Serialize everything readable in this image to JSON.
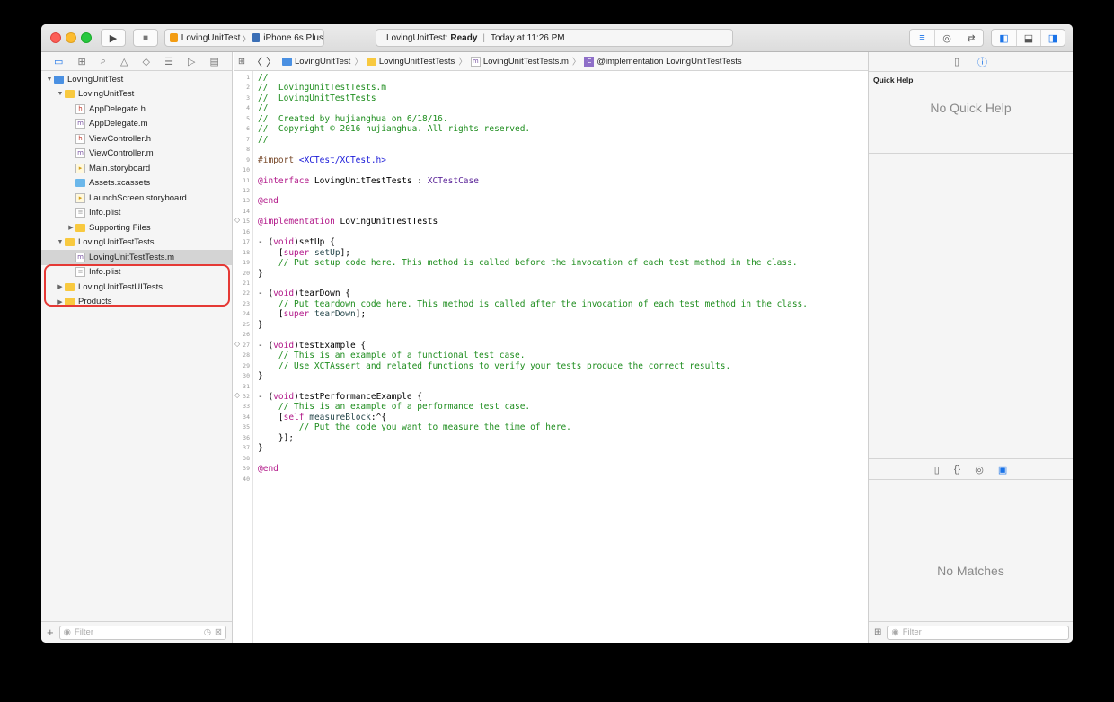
{
  "toolbar": {
    "run_icon": "▶",
    "stop_icon": "■",
    "scheme_name": "LovingUnitTest",
    "scheme_separator": "〉",
    "device_name": "iPhone 6s Plus",
    "status_project": "LovingUnitTest:",
    "status_state": "Ready",
    "status_divider": "|",
    "status_time": "Today at 11:26 PM",
    "editor_modes": [
      "standard-editor-icon",
      "assistant-editor-icon",
      "version-editor-icon"
    ],
    "panel_toggles": [
      "navigator-toggle-icon",
      "debug-toggle-icon",
      "utilities-toggle-icon"
    ]
  },
  "navigator": {
    "tabs": [
      "folder-icon",
      "symbol-icon",
      "search-icon",
      "issue-icon",
      "test-icon",
      "debug-icon",
      "breakpoint-icon",
      "report-icon"
    ],
    "items": [
      {
        "label": "LovingUnitTest",
        "kind": "project",
        "depth": 0,
        "disclosure": "▼"
      },
      {
        "label": "LovingUnitTest",
        "kind": "folder",
        "depth": 1,
        "disclosure": "▼"
      },
      {
        "label": "AppDelegate.h",
        "kind": "h",
        "depth": 2,
        "disclosure": ""
      },
      {
        "label": "AppDelegate.m",
        "kind": "m",
        "depth": 2,
        "disclosure": ""
      },
      {
        "label": "ViewController.h",
        "kind": "h",
        "depth": 2,
        "disclosure": ""
      },
      {
        "label": "ViewController.m",
        "kind": "m",
        "depth": 2,
        "disclosure": ""
      },
      {
        "label": "Main.storyboard",
        "kind": "storyboard",
        "depth": 2,
        "disclosure": ""
      },
      {
        "label": "Assets.xcassets",
        "kind": "xcassets",
        "depth": 2,
        "disclosure": ""
      },
      {
        "label": "LaunchScreen.storyboard",
        "kind": "storyboard",
        "depth": 2,
        "disclosure": ""
      },
      {
        "label": "Info.plist",
        "kind": "plist",
        "depth": 2,
        "disclosure": ""
      },
      {
        "label": "Supporting Files",
        "kind": "folder",
        "depth": 2,
        "disclosure": "▶"
      },
      {
        "label": "LovingUnitTestTests",
        "kind": "folder",
        "depth": 1,
        "disclosure": "▼"
      },
      {
        "label": "LovingUnitTestTests.m",
        "kind": "m",
        "depth": 2,
        "disclosure": "",
        "selected": true
      },
      {
        "label": "Info.plist",
        "kind": "plist",
        "depth": 2,
        "disclosure": ""
      },
      {
        "label": "LovingUnitTestUITests",
        "kind": "folder",
        "depth": 1,
        "disclosure": "▶"
      },
      {
        "label": "Products",
        "kind": "folder",
        "depth": 1,
        "disclosure": "▶"
      }
    ],
    "filter_placeholder": "Filter",
    "add_label": "+"
  },
  "jumpbar": {
    "crumbs": [
      {
        "label": "LovingUnitTest",
        "kind": "project"
      },
      {
        "label": "LovingUnitTestTests",
        "kind": "folder"
      },
      {
        "label": "LovingUnitTestTests.m",
        "kind": "m"
      },
      {
        "label": "@implementation LovingUnitTestTests",
        "kind": "class"
      }
    ],
    "back": "〈",
    "forward": "〉"
  },
  "editor": {
    "line_count": 40,
    "test_diamond_lines": [
      15,
      27,
      32
    ],
    "lines": [
      [
        {
          "t": "//",
          "c": "cm"
        }
      ],
      [
        {
          "t": "//  LovingUnitTestTests.m",
          "c": "cm"
        }
      ],
      [
        {
          "t": "//  LovingUnitTestTests",
          "c": "cm"
        }
      ],
      [
        {
          "t": "//",
          "c": "cm"
        }
      ],
      [
        {
          "t": "//  Created by hujianghua on 6/18/16.",
          "c": "cm"
        }
      ],
      [
        {
          "t": "//  Copyright © 2016 hujianghua. All rights reserved.",
          "c": "cm"
        }
      ],
      [
        {
          "t": "//",
          "c": "cm"
        }
      ],
      [],
      [
        {
          "t": "#import ",
          "c": "pp"
        },
        {
          "t": "<XCTest/XCTest.h>",
          "c": "lnk"
        }
      ],
      [],
      [
        {
          "t": "@interface",
          "c": "kw"
        },
        {
          "t": " LovingUnitTestTests : ",
          "c": ""
        },
        {
          "t": "XCTestCase",
          "c": "ty"
        }
      ],
      [],
      [
        {
          "t": "@end",
          "c": "kw"
        }
      ],
      [],
      [
        {
          "t": "@implementation",
          "c": "kw"
        },
        {
          "t": " LovingUnitTestTests",
          "c": ""
        }
      ],
      [],
      [
        {
          "t": "- (",
          "c": ""
        },
        {
          "t": "void",
          "c": "kw"
        },
        {
          "t": ")setUp {",
          "c": ""
        }
      ],
      [
        {
          "t": "    [",
          "c": ""
        },
        {
          "t": "super",
          "c": "kw"
        },
        {
          "t": " ",
          "c": ""
        },
        {
          "t": "setUp",
          "c": "fn"
        },
        {
          "t": "];",
          "c": ""
        }
      ],
      [
        {
          "t": "    // Put setup code here. This method is called before the invocation of each test method in the class.",
          "c": "cm"
        }
      ],
      [
        {
          "t": "}",
          "c": ""
        }
      ],
      [],
      [
        {
          "t": "- (",
          "c": ""
        },
        {
          "t": "void",
          "c": "kw"
        },
        {
          "t": ")tearDown {",
          "c": ""
        }
      ],
      [
        {
          "t": "    // Put teardown code here. This method is called after the invocation of each test method in the class.",
          "c": "cm"
        }
      ],
      [
        {
          "t": "    [",
          "c": ""
        },
        {
          "t": "super",
          "c": "kw"
        },
        {
          "t": " ",
          "c": ""
        },
        {
          "t": "tearDown",
          "c": "fn"
        },
        {
          "t": "];",
          "c": ""
        }
      ],
      [
        {
          "t": "}",
          "c": ""
        }
      ],
      [],
      [
        {
          "t": "- (",
          "c": ""
        },
        {
          "t": "void",
          "c": "kw"
        },
        {
          "t": ")testExample {",
          "c": ""
        }
      ],
      [
        {
          "t": "    // This is an example of a functional test case.",
          "c": "cm"
        }
      ],
      [
        {
          "t": "    // Use XCTAssert and related functions to verify your tests produce the correct results.",
          "c": "cm"
        }
      ],
      [
        {
          "t": "}",
          "c": ""
        }
      ],
      [],
      [
        {
          "t": "- (",
          "c": ""
        },
        {
          "t": "void",
          "c": "kw"
        },
        {
          "t": ")testPerformanceExample {",
          "c": ""
        }
      ],
      [
        {
          "t": "    // This is an example of a performance test case.",
          "c": "cm"
        }
      ],
      [
        {
          "t": "    [",
          "c": ""
        },
        {
          "t": "self",
          "c": "kw"
        },
        {
          "t": " ",
          "c": ""
        },
        {
          "t": "measureBlock",
          "c": "fn"
        },
        {
          "t": ":^{",
          "c": ""
        }
      ],
      [
        {
          "t": "        // Put the code you want to measure the time of here.",
          "c": "cm"
        }
      ],
      [
        {
          "t": "    }];",
          "c": ""
        }
      ],
      [
        {
          "t": "}",
          "c": ""
        }
      ],
      [],
      [
        {
          "t": "@end",
          "c": "kw"
        }
      ],
      []
    ]
  },
  "utilities": {
    "tabs": [
      "file-inspector-icon",
      "quick-help-icon"
    ],
    "quick_help_title": "Quick Help",
    "quick_help_empty": "No Quick Help",
    "library_tabs": [
      "file-template-icon",
      "code-snippet-icon",
      "object-library-icon",
      "media-library-icon"
    ],
    "no_matches": "No Matches",
    "filter_placeholder": "Filter"
  },
  "colors": {
    "comment": "#1e8d1e",
    "keyword": "#b21889",
    "preprocessor": "#78492a",
    "link": "#1a1ad8",
    "type": "#5c2699",
    "highlight_ring": "#e53935",
    "accent": "#1a73e8"
  }
}
